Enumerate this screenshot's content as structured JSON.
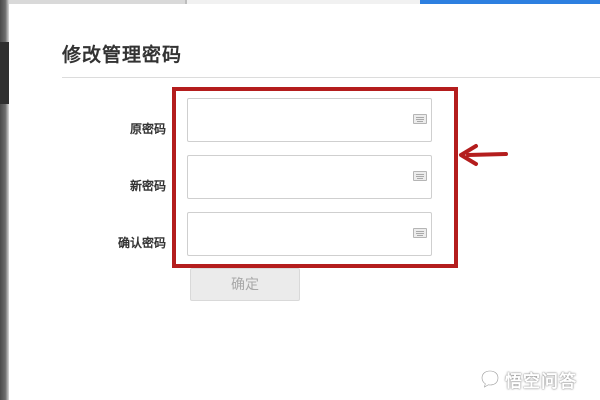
{
  "dialog": {
    "title": "修改管理密码"
  },
  "form": {
    "fields": [
      {
        "label": "原密码",
        "value": "",
        "keyboard_icon": "keyboard-icon"
      },
      {
        "label": "新密码",
        "value": "",
        "keyboard_icon": "keyboard-icon"
      },
      {
        "label": "确认密码",
        "value": "",
        "keyboard_icon": "keyboard-icon"
      }
    ],
    "confirm_label": "确定"
  },
  "annotation": {
    "color": "#b41d1d",
    "arrow_icon": "arrow-left-icon"
  },
  "watermark": {
    "text": "悟空问答",
    "icon": "chat-bubble-icon"
  },
  "colors": {
    "accent": "#2d7fe0",
    "disabled_button": "#ebebeb",
    "highlight": "#b41d1d"
  }
}
